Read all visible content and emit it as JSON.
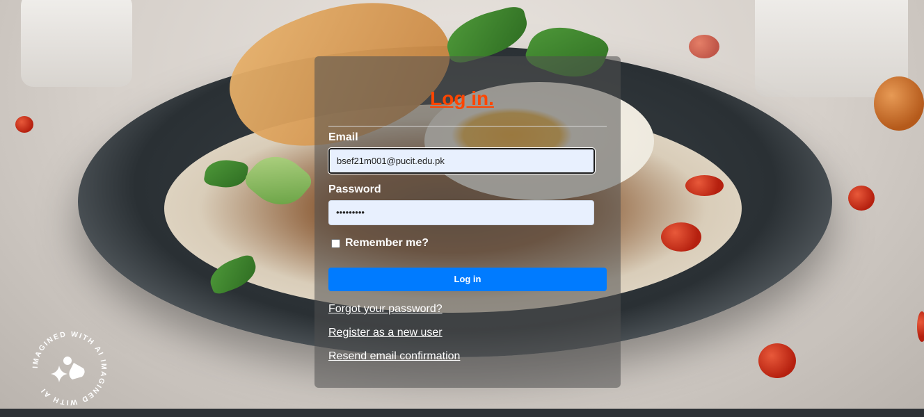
{
  "login": {
    "title": "Log in.",
    "email_label": "Email",
    "email_value": "bsef21m001@pucit.edu.pk",
    "password_label": "Password",
    "password_value": "•••••••••",
    "remember_label": "Remember me?",
    "submit_label": "Log in"
  },
  "links": {
    "forgot": "Forgot your password?",
    "register": "Register as a new user",
    "resend": "Resend email confirmation"
  },
  "badge": {
    "text": "IMAGINED WITH AI IMAGINED WITH AI",
    "icon": "sparkle-icon"
  },
  "colors": {
    "title": "#ff4500",
    "button": "#007bff",
    "field_bg": "#e8f0fe"
  }
}
